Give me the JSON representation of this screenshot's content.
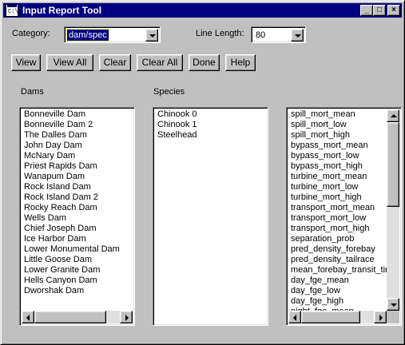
{
  "window": {
    "title": "Input Report Tool",
    "icon_text": "C:\\",
    "minimize_glyph": "_",
    "maximize_glyph": "□",
    "close_glyph": "×"
  },
  "controls": {
    "category_label": "Category:",
    "category_value": "dam/spec",
    "line_length_label": "Line Length:",
    "line_length_value": "80"
  },
  "toolbar": {
    "buttons": [
      "View",
      "View All",
      "Clear",
      "Clear All",
      "Done",
      "Help"
    ]
  },
  "dams": {
    "heading": "Dams",
    "items": [
      "Bonneville Dam",
      "Bonneville Dam 2",
      "The Dalles Dam",
      "John Day Dam",
      "McNary Dam",
      "Priest Rapids Dam",
      "Wanapum Dam",
      "Rock Island Dam",
      "Rock Island Dam 2",
      "Rocky Reach Dam",
      "Wells Dam",
      "Chief Joseph Dam",
      "Ice Harbor Dam",
      "Lower Monumental Dam",
      "Little Goose Dam",
      "Lower Granite Dam",
      "Hells Canyon Dam",
      "Dworshak Dam"
    ]
  },
  "species": {
    "heading": "Species",
    "items": [
      "Chinook 0",
      "Chinook 1",
      "Steelhead"
    ]
  },
  "parameters": {
    "items": [
      "spill_mort_mean",
      "spill_mort_low",
      "spill_mort_high",
      "bypass_mort_mean",
      "bypass_mort_low",
      "bypass_mort_high",
      "turbine_mort_mean",
      "turbine_mort_low",
      "turbine_mort_high",
      "transport_mort_mean",
      "transport_mort_low",
      "transport_mort_high",
      "separation_prob",
      "pred_density_forebay",
      "pred_density_tailrace",
      "mean_forebay_transit_time",
      "day_fge_mean",
      "day_fge_low",
      "day_fge_high",
      "night_fge_mean"
    ]
  },
  "colors": {
    "titlebar": "#000080",
    "face": "#c0c0c0",
    "selection": "#000080"
  }
}
